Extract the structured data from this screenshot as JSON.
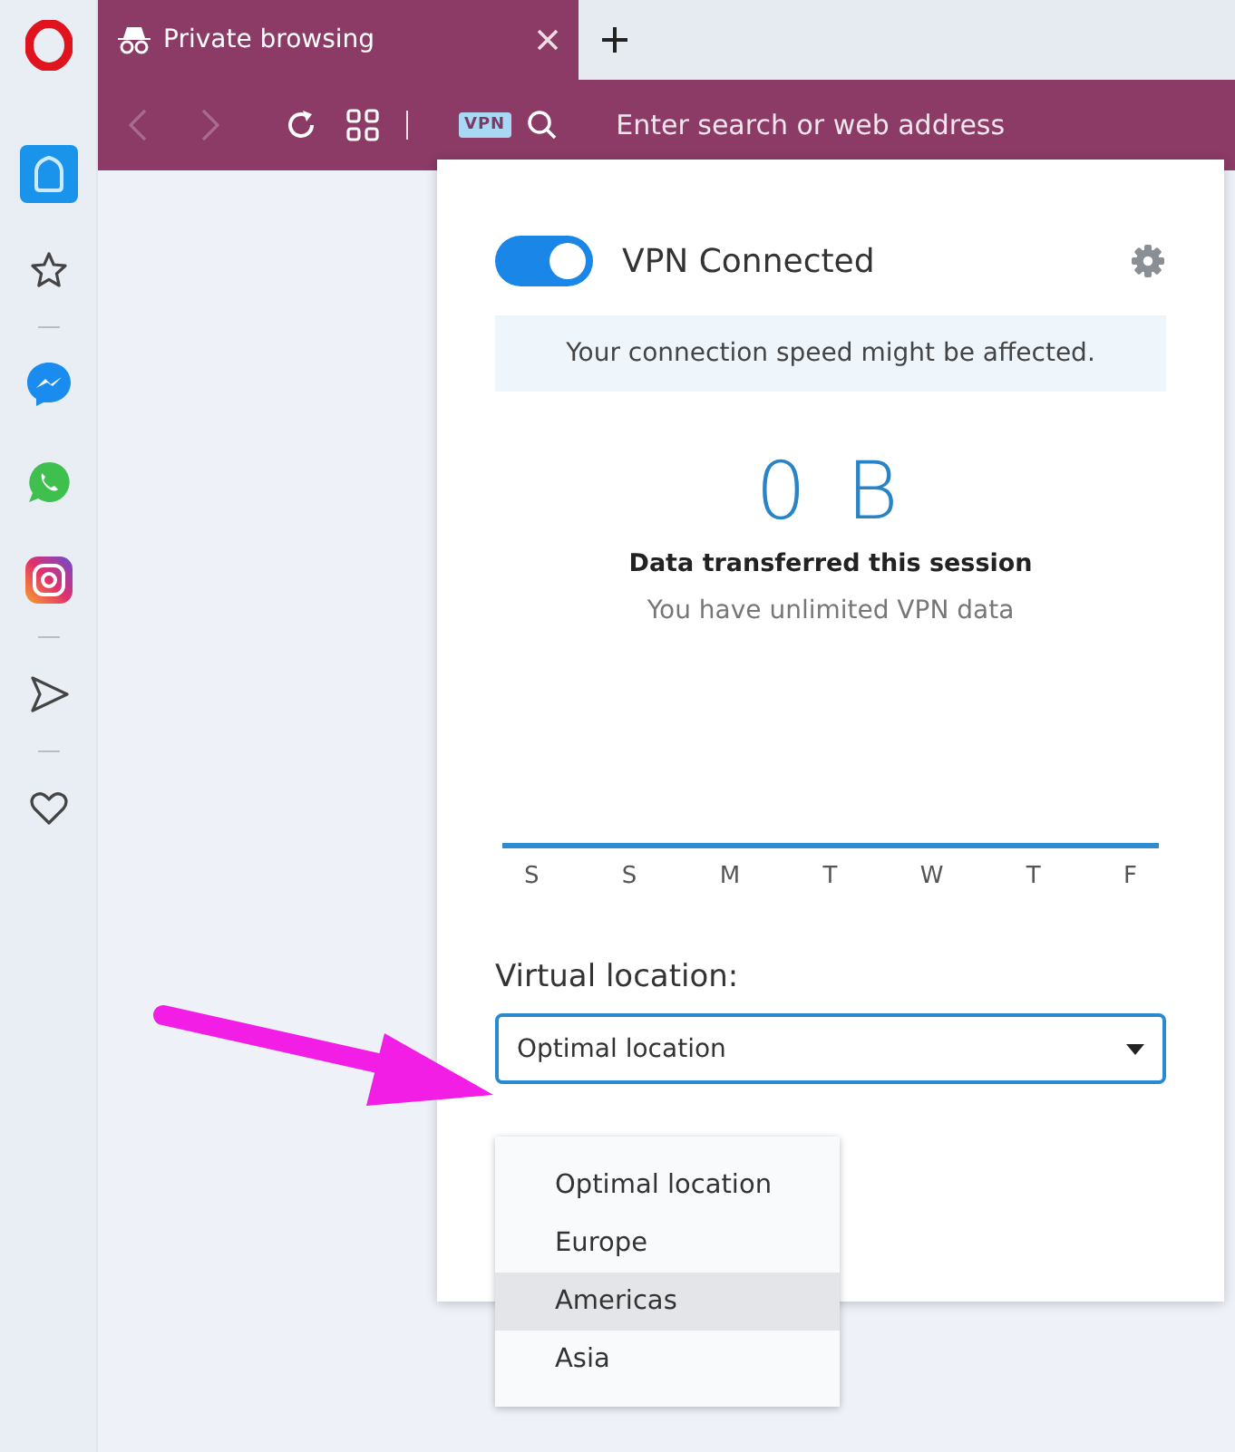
{
  "browser": {
    "tab": {
      "title": "Private browsing"
    },
    "address_bar": {
      "vpn_badge": "VPN",
      "placeholder": "Enter search or web address"
    }
  },
  "sidebar": {
    "items": [
      {
        "kind": "home",
        "selected": true
      },
      {
        "kind": "star",
        "selected": false
      },
      {
        "kind": "divider"
      },
      {
        "kind": "messenger",
        "selected": false
      },
      {
        "kind": "whatsapp",
        "selected": false
      },
      {
        "kind": "instagram",
        "selected": false
      },
      {
        "kind": "divider"
      },
      {
        "kind": "send",
        "selected": false
      },
      {
        "kind": "divider"
      },
      {
        "kind": "heart",
        "selected": false
      }
    ]
  },
  "vpn_panel": {
    "enabled": true,
    "status": "VPN Connected",
    "notice": "Your connection speed might be affected.",
    "data_amount": "0 B",
    "data_label": "Data transferred this session",
    "data_note": "You have unlimited VPN data",
    "days": [
      "S",
      "S",
      "M",
      "T",
      "W",
      "T",
      "F"
    ],
    "location_label": "Virtual location:",
    "location_value": "Optimal location",
    "options": [
      {
        "label": "Optimal location",
        "selected": false
      },
      {
        "label": "Europe",
        "selected": false
      },
      {
        "label": "Americas",
        "selected": true
      },
      {
        "label": "Asia",
        "selected": false
      }
    ]
  }
}
